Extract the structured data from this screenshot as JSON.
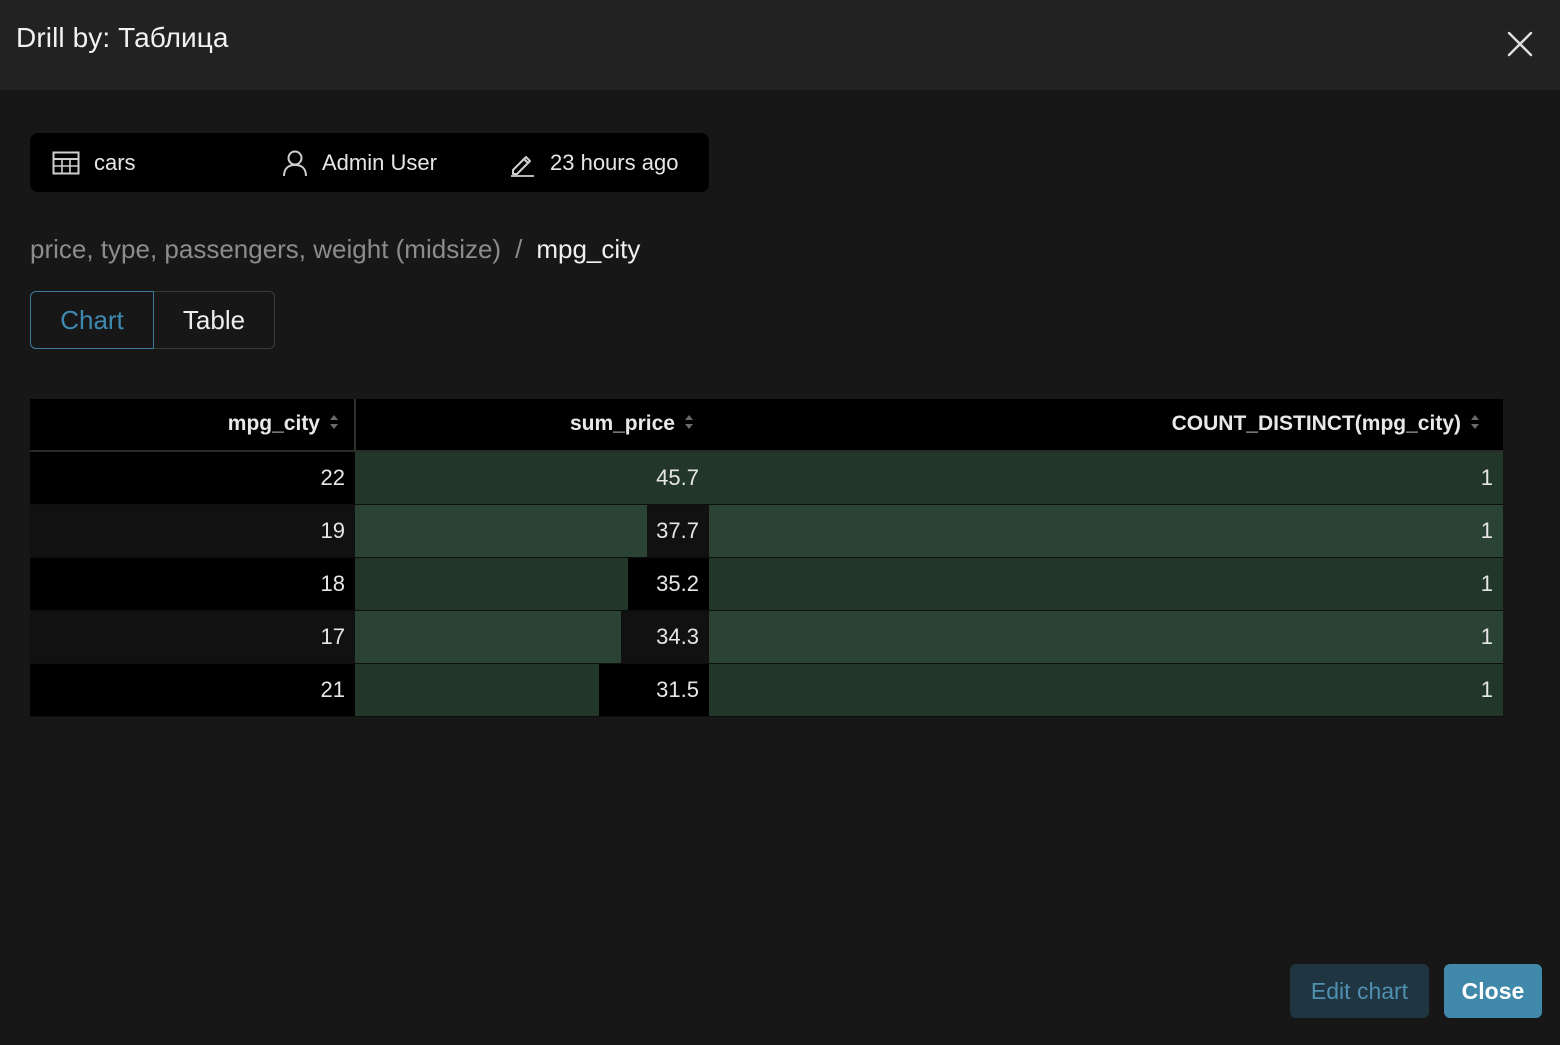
{
  "header": {
    "title": "Drill by: Таблица"
  },
  "meta": {
    "dataset": "cars",
    "owner": "Admin User",
    "modified": "23 hours ago"
  },
  "breadcrumb": {
    "previous": "price, type, passengers, weight (midsize)",
    "separator": "/",
    "current": "mpg_city"
  },
  "view_toggle": {
    "options": [
      "Chart",
      "Table"
    ],
    "selected": "Chart"
  },
  "table": {
    "columns": [
      "mpg_city",
      "sum_price",
      "COUNT_DISTINCT(mpg_city)"
    ],
    "rows": [
      {
        "mpg_city": "22",
        "sum_price": "45.7",
        "count_distinct": "1"
      },
      {
        "mpg_city": "19",
        "sum_price": "37.7",
        "count_distinct": "1"
      },
      {
        "mpg_city": "18",
        "sum_price": "35.2",
        "count_distinct": "1"
      },
      {
        "mpg_city": "17",
        "sum_price": "34.3",
        "count_distinct": "1"
      },
      {
        "mpg_city": "21",
        "sum_price": "31.5",
        "count_distinct": "1"
      }
    ]
  },
  "footer": {
    "edit_label": "Edit chart",
    "close_label": "Close"
  },
  "colors": {
    "bar_fill": "#22362a",
    "bar_fill_alt": "#2a4334",
    "accent": "#4189ab"
  }
}
